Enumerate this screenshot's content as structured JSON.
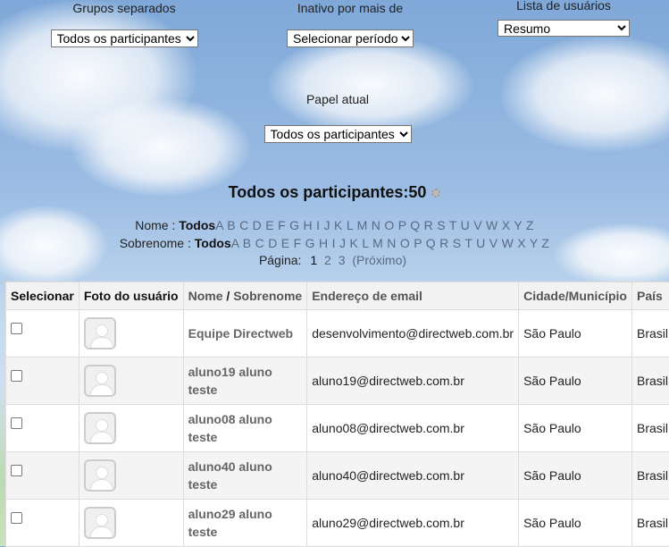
{
  "filters": {
    "groups": {
      "label": "Grupos separados",
      "selected": "Todos os participantes"
    },
    "inactive": {
      "label": "Inativo por mais de",
      "selected": "Selecionar período"
    },
    "userlist": {
      "label": "Lista de usuários",
      "selected": "Resumo"
    },
    "role": {
      "label": "Papel atual",
      "selected": "Todos os participantes"
    }
  },
  "heading": "Todos os participantes:50",
  "alpha": {
    "first": {
      "label": "Nome :",
      "current": "Todos",
      "letters": "A B C D E F G H I J K L M N O P Q R S T U V W X Y Z"
    },
    "last": {
      "label": "Sobrenome :",
      "current": "Todos",
      "letters": "A B C D E F G H I J K L M N O P Q R S T U V W X Y Z"
    }
  },
  "paging": {
    "label": "Página:",
    "current": "1",
    "p2": "2",
    "p3": "3",
    "next": "(Próximo)"
  },
  "table": {
    "headers": [
      "Selecionar",
      "Foto do usuário",
      "Nome",
      "/",
      "Sobrenome",
      "Endereço de email",
      "Cidade/Município",
      "País"
    ],
    "rows": [
      {
        "name": "Equipe Directweb",
        "email": "desenvolvimento@directweb.com.br",
        "city": "São Paulo",
        "country": "Brasil"
      },
      {
        "name": "aluno19 aluno teste",
        "email": "aluno19@directweb.com.br",
        "city": "São Paulo",
        "country": "Brasil"
      },
      {
        "name": "aluno08 aluno teste",
        "email": "aluno08@directweb.com.br",
        "city": "São Paulo",
        "country": "Brasil"
      },
      {
        "name": "aluno40 aluno teste",
        "email": "aluno40@directweb.com.br",
        "city": "São Paulo",
        "country": "Brasil"
      },
      {
        "name": "aluno29 aluno teste",
        "email": "aluno29@directweb.com.br",
        "city": "São Paulo",
        "country": "Brasil"
      }
    ]
  }
}
